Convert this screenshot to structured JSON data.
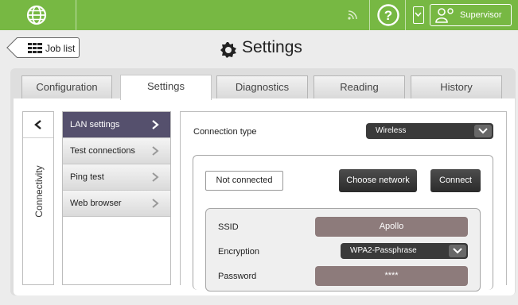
{
  "topbar": {
    "user_label": "Supervisor",
    "icons": [
      "globe-icon",
      "rss-icon",
      "help-icon",
      "chevron-down-icon",
      "user-icon"
    ],
    "colors": {
      "bar": "#77b843",
      "icon": "#ffffff"
    }
  },
  "header": {
    "back_label": "Job list",
    "title": "Settings",
    "icons": [
      "grid-icon",
      "gear-icon"
    ]
  },
  "tabs": [
    {
      "label": "Configuration",
      "active": false
    },
    {
      "label": "Settings",
      "active": true
    },
    {
      "label": "Diagnostics",
      "active": false
    },
    {
      "label": "Reading",
      "active": false
    },
    {
      "label": "History",
      "active": false
    }
  ],
  "sidepanel": {
    "label": "Connectivity",
    "icon": "chevron-left-icon"
  },
  "menu": {
    "items": [
      {
        "label": "LAN settings",
        "active": true
      },
      {
        "label": "Test connections",
        "active": false
      },
      {
        "label": "Ping test",
        "active": false
      },
      {
        "label": "Web browser",
        "active": false
      }
    ],
    "colors": {
      "active_bg": "#55506d",
      "active_text": "#ffffff"
    }
  },
  "lan": {
    "connection_type_label": "Connection type",
    "connection_type_value": "Wireless",
    "status": "Not connected",
    "choose_network_label": "Choose network",
    "connect_label": "Connect",
    "ssid_label": "SSID",
    "ssid_value": "Apollo",
    "encryption_label": "Encryption",
    "encryption_value": "WPA2-Passphrase",
    "password_label": "Password",
    "password_value": "****",
    "colors": {
      "value_box": "#8d7b7b",
      "dark_button": "#333333"
    }
  }
}
